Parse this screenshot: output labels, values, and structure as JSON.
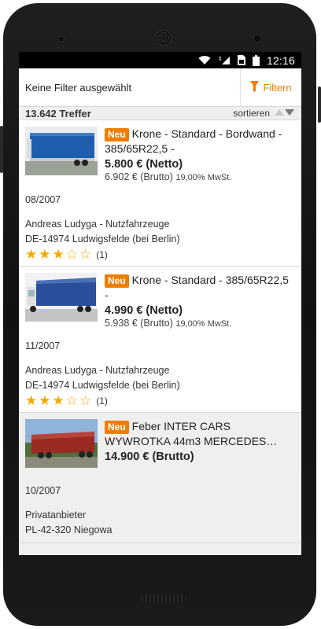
{
  "status": {
    "time": "12:16"
  },
  "filter": {
    "label": "Keine Filter ausgewählt",
    "button": "Filtern"
  },
  "results": {
    "count": "13.642 Treffer",
    "sort_label": "sortieren"
  },
  "listings": [
    {
      "badge": "Neu",
      "title": "Krone - Standard - Bordwand - 385/65R22,5 -",
      "price_net": "5.800 € (Netto)",
      "price_gross": "6.902 € (Brutto)",
      "vat": "19,00% MwSt.",
      "date": "08/2007",
      "seller": "Andreas Ludyga - Nutzfahrzeuge",
      "location": "DE-14974 Ludwigsfelde (bei Berlin)",
      "rating": 3,
      "rating_max": 5,
      "rating_count": "(1)"
    },
    {
      "badge": "Neu",
      "title": "Krone - Standard - 385/65R22,5 -",
      "price_net": "4.990 € (Netto)",
      "price_gross": "5.938 € (Brutto)",
      "vat": "19,00% MwSt.",
      "date": "11/2007",
      "seller": "Andreas Ludyga - Nutzfahrzeuge",
      "location": "DE-14974 Ludwigsfelde (bei Berlin)",
      "rating": 3,
      "rating_max": 5,
      "rating_count": "(1)"
    },
    {
      "badge": "Neu",
      "title_line1": "Feber INTER CARS",
      "title_line2": "WYWROTKA 44m3 MERCEDES…",
      "price_gross_bold": "14.900 € (Brutto)",
      "date": "10/2007",
      "seller": "Privatanbieter",
      "location": "PL-42-320 Niegowa"
    }
  ],
  "colors": {
    "accent": "#f07d00",
    "star": "#f5a800"
  },
  "icons": {
    "status": [
      "wifi-icon",
      "signal-icon",
      "sim-icon",
      "battery-icon"
    ],
    "filter": "funnel-icon",
    "sort": "sort-arrows-icon"
  }
}
